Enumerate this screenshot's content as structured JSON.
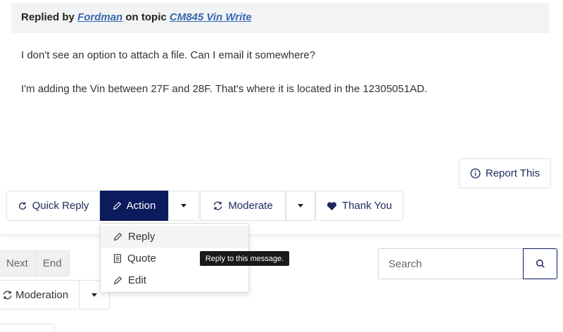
{
  "post": {
    "header_prefix": "Replied by",
    "author": "Fordman",
    "header_mid": "on topic",
    "topic": "CM845 Vin Write",
    "body": [
      "I don't see an option to attach a file. Can I email it somewhere?",
      "I'm adding the Vin between 27F and 28F. That's where it is located in the  12305051AD."
    ]
  },
  "actions": {
    "report": "Report This",
    "quick_reply": "Quick Reply",
    "action": "Action",
    "moderate": "Moderate",
    "thank_you": "Thank You"
  },
  "dropdown": {
    "items": [
      {
        "label": "Reply",
        "icon": "pencil-icon"
      },
      {
        "label": "Quote",
        "icon": "document-icon"
      },
      {
        "label": "Edit",
        "icon": "pencil-icon"
      }
    ]
  },
  "tooltip": "Reply to this message.",
  "pager": {
    "next": "Next",
    "end": "End"
  },
  "search": {
    "placeholder": "Search"
  },
  "moderation": {
    "label": "Moderation"
  },
  "colors": {
    "primary": "#0c1a5e",
    "link": "#3a68b0",
    "header_bg": "#f1f3f5"
  }
}
